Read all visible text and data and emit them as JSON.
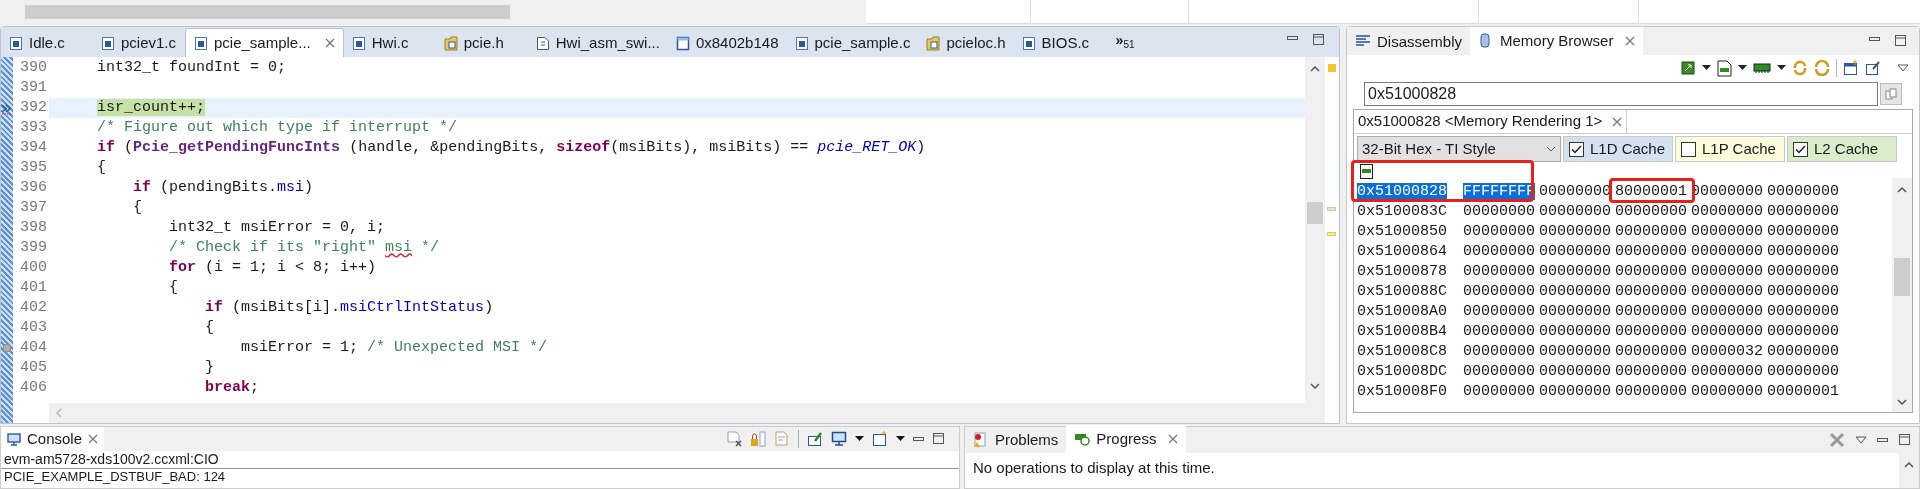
{
  "editor": {
    "tabs": [
      {
        "label": "Idle.c",
        "kind": "c",
        "selected": false
      },
      {
        "label": "pciev1.c",
        "kind": "c",
        "selected": false
      },
      {
        "label": "pcie_sample...",
        "kind": "c",
        "selected": true
      },
      {
        "label": "Hwi.c",
        "kind": "c",
        "selected": false
      },
      {
        "label": "pcie.h",
        "kind": "h",
        "selected": false
      },
      {
        "label": "Hwi_asm_swi...",
        "kind": "s",
        "selected": false
      },
      {
        "label": "0x8402b148",
        "kind": "mem",
        "selected": false
      },
      {
        "label": "pcie_sample.c",
        "kind": "c",
        "selected": false
      },
      {
        "label": "pcieloc.h",
        "kind": "h",
        "selected": false
      },
      {
        "label": "BIOS.c",
        "kind": "c",
        "selected": false
      }
    ],
    "overflow": {
      "symbol": "»",
      "count": "51"
    },
    "lines": [
      {
        "number": "390",
        "kind": "code",
        "tokens": [
          {
            "kind": "plain",
            "text": "    int32_t foundInt = 0;"
          }
        ]
      },
      {
        "number": "391",
        "kind": "code"
      },
      {
        "number": "392",
        "kind": "current_instruction",
        "tokens": [
          {
            "kind": "current",
            "text": "    isr_count++;"
          }
        ]
      },
      {
        "number": "393",
        "kind": "code",
        "tokens": [
          {
            "kind": "comment",
            "text": "    /* Figure out which type if interrupt */"
          }
        ]
      },
      {
        "number": "394",
        "kind": "code",
        "tokens": [
          {
            "kind": "keyword",
            "text": "    if"
          },
          {
            "kind": "plain",
            "text": " ("
          },
          {
            "kind": "function",
            "text": "Pcie_getPendingFuncInts"
          },
          {
            "kind": "plain",
            "text": " (handle, &pendingBits, "
          },
          {
            "kind": "keyword",
            "text": "sizeof"
          },
          {
            "kind": "plain",
            "text": "(msiBits), msiBits) == "
          },
          {
            "kind": "constant",
            "text": "pcie_RET_OK"
          },
          {
            "kind": "plain",
            "text": ")"
          }
        ]
      },
      {
        "number": "395",
        "kind": "code",
        "tokens": [
          {
            "kind": "plain",
            "text": "    {"
          }
        ]
      },
      {
        "number": "396",
        "kind": "code",
        "tokens": [
          {
            "kind": "keyword",
            "text": "        if"
          },
          {
            "kind": "plain",
            "text": " (pendingBits."
          },
          {
            "kind": "field",
            "text": "msi"
          },
          {
            "kind": "plain",
            "text": ")"
          }
        ]
      },
      {
        "number": "397",
        "kind": "code",
        "tokens": [
          {
            "kind": "plain",
            "text": "        {"
          }
        ]
      },
      {
        "number": "398",
        "kind": "code",
        "tokens": [
          {
            "kind": "plain",
            "text": "            int32_t msiError = 0, i;"
          }
        ]
      },
      {
        "number": "399",
        "kind": "code",
        "tokens": [
          {
            "kind": "comment",
            "text": "            /* Check if its \"right\" "
          },
          {
            "kind": "spelling",
            "text": "msi"
          },
          {
            "kind": "comment",
            "text": " */"
          }
        ]
      },
      {
        "number": "400",
        "kind": "code",
        "tokens": [
          {
            "kind": "keyword",
            "text": "            for"
          },
          {
            "kind": "plain",
            "text": " (i = 1; i < 8; i++)"
          }
        ]
      },
      {
        "number": "401",
        "kind": "code",
        "tokens": [
          {
            "kind": "plain",
            "text": "            {"
          }
        ]
      },
      {
        "number": "402",
        "kind": "code",
        "tokens": [
          {
            "kind": "keyword",
            "text": "                if"
          },
          {
            "kind": "plain",
            "text": " (msiBits[i]."
          },
          {
            "kind": "field",
            "text": "msiCtrlIntStatus"
          },
          {
            "kind": "plain",
            "text": ")"
          }
        ]
      },
      {
        "number": "403",
        "kind": "code",
        "tokens": [
          {
            "kind": "plain",
            "text": "                {"
          }
        ]
      },
      {
        "number": "404",
        "kind": "breakpoint",
        "tokens": [
          {
            "kind": "plain",
            "text": "                    msiError = 1; "
          },
          {
            "kind": "comment",
            "text": "/* Unexpected MSI */"
          }
        ]
      },
      {
        "number": "405",
        "kind": "code",
        "tokens": [
          {
            "kind": "plain",
            "text": "                }"
          }
        ]
      },
      {
        "number": "406",
        "kind": "code",
        "tokens": [
          {
            "kind": "keyword",
            "text": "                break"
          },
          {
            "kind": "plain",
            "text": ";"
          }
        ]
      }
    ]
  },
  "memory_panel": {
    "tabs": [
      {
        "label": "Disassembly",
        "kind": "disasm",
        "selected": false
      },
      {
        "label": "Memory Browser",
        "kind": "memory",
        "selected": true
      }
    ],
    "address_field": {
      "value": "0x51000828"
    },
    "rendering_tab": {
      "label": "0x51000828 <Memory Rendering 1>"
    },
    "format": {
      "value": "32-Bit Hex - TI Style"
    },
    "caches": [
      {
        "label": "L1D Cache",
        "checked": true,
        "color": "#d3e2ee"
      },
      {
        "label": "L1P Cache",
        "checked": false,
        "color": "#fcfbdc"
      },
      {
        "label": "L2 Cache",
        "checked": true,
        "color": "#d9edcb"
      }
    ],
    "rows": [
      {
        "address": "0x51000828",
        "selected": true,
        "values": [
          {
            "text": "FFFFFFFF",
            "selected": true
          },
          {
            "text": "00000000",
            "selected": false
          },
          {
            "text": "80000001",
            "selected": false
          },
          {
            "text": "00000000",
            "selected": false
          },
          {
            "text": "00000000",
            "selected": false
          }
        ]
      },
      {
        "address": "0x5100083C",
        "selected": false,
        "values": [
          {
            "text": "00000000",
            "selected": false
          },
          {
            "text": "00000000",
            "selected": false
          },
          {
            "text": "00000000",
            "selected": false
          },
          {
            "text": "00000000",
            "selected": false
          },
          {
            "text": "00000000",
            "selected": false
          }
        ]
      },
      {
        "address": "0x51000850",
        "selected": false,
        "values": [
          {
            "text": "00000000",
            "selected": false
          },
          {
            "text": "00000000",
            "selected": false
          },
          {
            "text": "00000000",
            "selected": false
          },
          {
            "text": "00000000",
            "selected": false
          },
          {
            "text": "00000000",
            "selected": false
          }
        ]
      },
      {
        "address": "0x51000864",
        "selected": false,
        "values": [
          {
            "text": "00000000",
            "selected": false
          },
          {
            "text": "00000000",
            "selected": false
          },
          {
            "text": "00000000",
            "selected": false
          },
          {
            "text": "00000000",
            "selected": false
          },
          {
            "text": "00000000",
            "selected": false
          }
        ]
      },
      {
        "address": "0x51000878",
        "selected": false,
        "values": [
          {
            "text": "00000000",
            "selected": false
          },
          {
            "text": "00000000",
            "selected": false
          },
          {
            "text": "00000000",
            "selected": false
          },
          {
            "text": "00000000",
            "selected": false
          },
          {
            "text": "00000000",
            "selected": false
          }
        ]
      },
      {
        "address": "0x5100088C",
        "selected": false,
        "values": [
          {
            "text": "00000000",
            "selected": false
          },
          {
            "text": "00000000",
            "selected": false
          },
          {
            "text": "00000000",
            "selected": false
          },
          {
            "text": "00000000",
            "selected": false
          },
          {
            "text": "00000000",
            "selected": false
          }
        ]
      },
      {
        "address": "0x510008A0",
        "selected": false,
        "values": [
          {
            "text": "00000000",
            "selected": false
          },
          {
            "text": "00000000",
            "selected": false
          },
          {
            "text": "00000000",
            "selected": false
          },
          {
            "text": "00000000",
            "selected": false
          },
          {
            "text": "00000000",
            "selected": false
          }
        ]
      },
      {
        "address": "0x510008B4",
        "selected": false,
        "values": [
          {
            "text": "00000000",
            "selected": false
          },
          {
            "text": "00000000",
            "selected": false
          },
          {
            "text": "00000000",
            "selected": false
          },
          {
            "text": "00000000",
            "selected": false
          },
          {
            "text": "00000000",
            "selected": false
          }
        ]
      },
      {
        "address": "0x510008C8",
        "selected": false,
        "values": [
          {
            "text": "00000000",
            "selected": false
          },
          {
            "text": "00000000",
            "selected": false
          },
          {
            "text": "00000000",
            "selected": false
          },
          {
            "text": "00000032",
            "selected": false
          },
          {
            "text": "00000000",
            "selected": false
          }
        ]
      },
      {
        "address": "0x510008DC",
        "selected": false,
        "values": [
          {
            "text": "00000000",
            "selected": false
          },
          {
            "text": "00000000",
            "selected": false
          },
          {
            "text": "00000000",
            "selected": false
          },
          {
            "text": "00000000",
            "selected": false
          },
          {
            "text": "00000000",
            "selected": false
          }
        ]
      },
      {
        "address": "0x510008F0",
        "selected": false,
        "values": [
          {
            "text": "00000000",
            "selected": false
          },
          {
            "text": "00000000",
            "selected": false
          },
          {
            "text": "00000000",
            "selected": false
          },
          {
            "text": "00000000",
            "selected": false
          },
          {
            "text": "00000001",
            "selected": false
          }
        ]
      }
    ]
  },
  "console": {
    "tab": {
      "label": "Console"
    },
    "session": "evm-am5728-xds100v2.ccxml:CIO",
    "lines": [
      "PCIE_EXAMPLE_DSTBUF_BAD: 124"
    ]
  },
  "progress_panel": {
    "tabs": [
      {
        "label": "Problems",
        "kind": "problems",
        "selected": false
      },
      {
        "label": "Progress",
        "kind": "progress",
        "selected": true
      }
    ],
    "message": "No operations to display at this time."
  }
}
